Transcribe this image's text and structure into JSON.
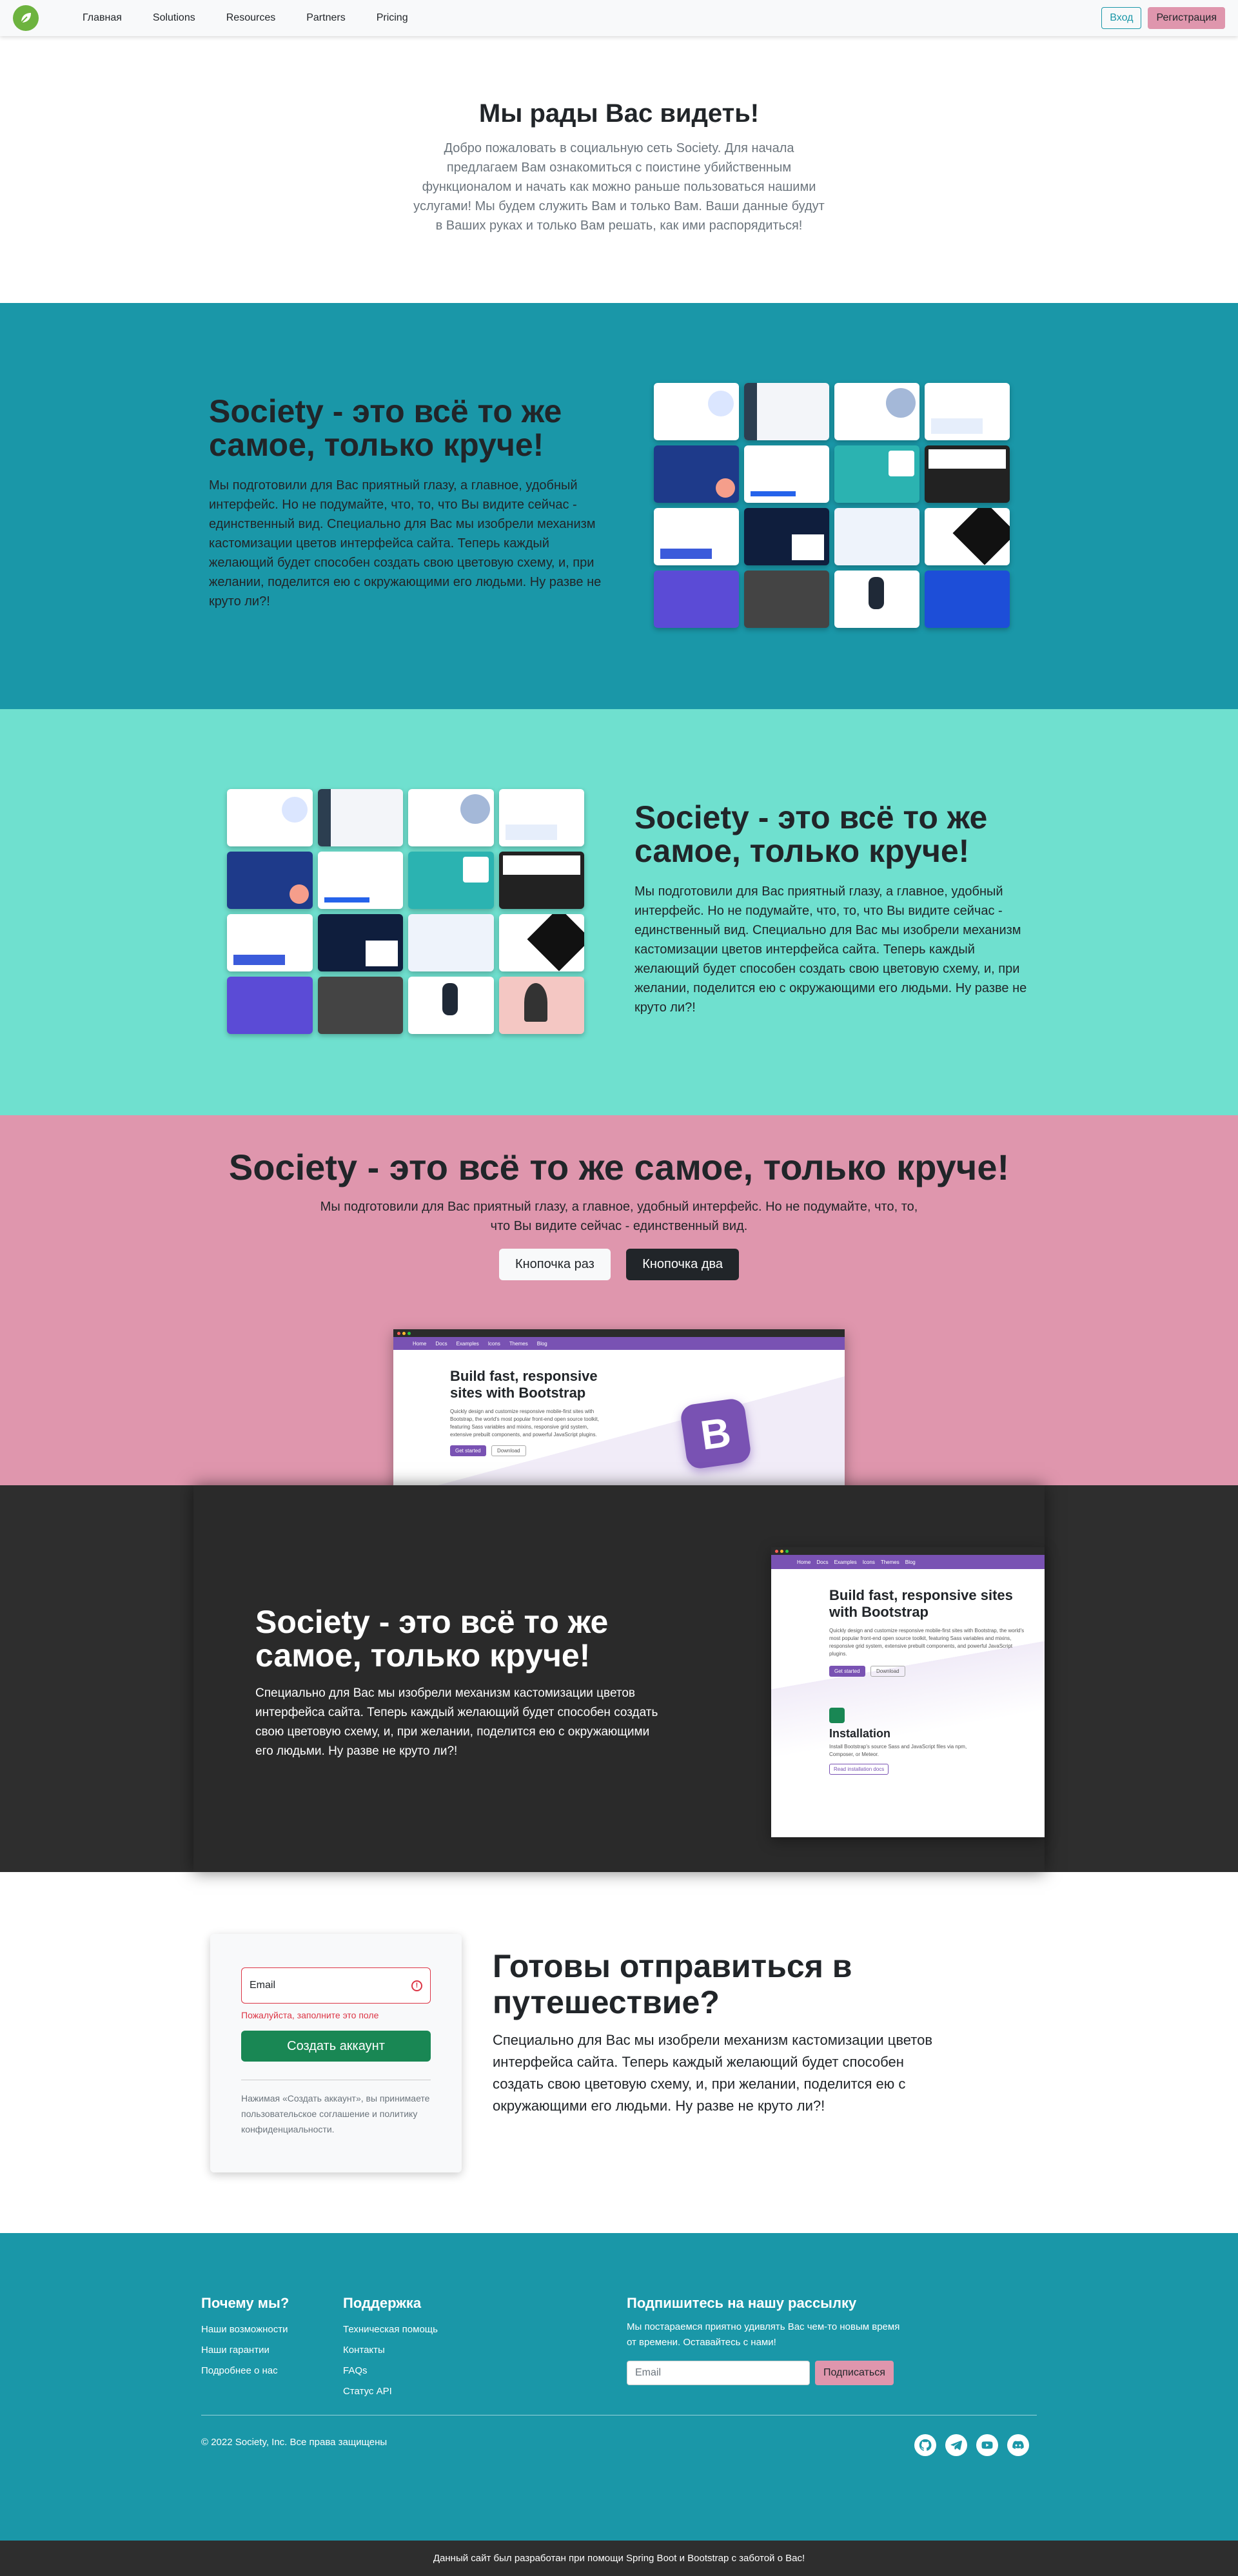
{
  "nav": {
    "links": [
      "Главная",
      "Solutions",
      "Resources",
      "Partners",
      "Pricing"
    ],
    "login": "Вход",
    "register": "Регистрация"
  },
  "hero": {
    "title": "Мы рады Вас видеть!",
    "text": "Добро пожаловать в социальную сеть Society. Для начала предлагаем Вам ознакомиться с поистине убийственным функционалом и начать как можно раньше пользоваться нашими услугами! Мы будем служить Вам и только Вам. Ваши данные будут в Ваших руках и только Вам решать, как ими распорядиться!"
  },
  "feature1": {
    "title": "Society - это всё то же самое, только круче!",
    "text": "Мы подготовили для Вас приятный глазу, а главное, удобный интерфейс. Но не подумайте, что, то, что Вы видите сейчас - единственный вид. Специально для Вас мы изобрели механизм кастомизации цветов интерфейса сайта. Теперь каждый желающий будет способен создать свою цветовую схему, и, при желании, поделится ею с окружающими его людьми. Ну разве не круто ли?!"
  },
  "feature2": {
    "title": "Society - это всё то же самое, только круче!",
    "text": "Мы подготовили для Вас приятный глазу, а главное, удобный интерфейс. Но не подумайте, что, то, что Вы видите сейчас - единственный вид. Специально для Вас мы изобрели механизм кастомизации цветов интерфейса сайта. Теперь каждый желающий будет способен создать свою цветовую схему, и, при желании, поделится ею с окружающими его людьми. Ну разве не круто ли?!"
  },
  "feature3": {
    "title": "Society - это всё то же самое, только круче!",
    "text": "Мы подготовили для Вас приятный глазу, а главное, удобный интерфейс. Но не подумайте, что, то, что Вы видите сейчас - единственный вид.",
    "button1": "Кнопочка раз",
    "button2": "Кнопочка два"
  },
  "feature4": {
    "title": "Society - это всё то же самое, только круче!",
    "text": "Специально для Вас мы изобрели механизм кастомизации цветов интерфейса сайта. Теперь каждый желающий будет способен создать свою цветовую схему, и, при желании, поделится ею с окружающими его людьми. Ну разве не круто ли?!"
  },
  "bootstrap_preview": {
    "nav_items": [
      "Home",
      "Docs",
      "Examples",
      "Icons",
      "Themes",
      "Blog"
    ],
    "title": "Build fast, responsive sites with Bootstrap",
    "text": "Quickly design and customize responsive mobile-first sites with Bootstrap, the world's most popular front-end open source toolkit, featuring Sass variables and mixins, responsive grid system, extensive prebuilt components, and powerful JavaScript plugins.",
    "btn_primary": "Get started",
    "btn_secondary": "Download",
    "logo_letter": "B",
    "install_title": "Installation",
    "install_text": "Install Bootstrap's source Sass and JavaScript files via npm, Composer, or Meteor.",
    "install_link": "Read installation docs"
  },
  "signup": {
    "email_placeholder": "Email",
    "error": "Пожалуйста, заполните это поле",
    "button": "Создать аккаунт",
    "terms": "Нажимая «Создать аккаунт», вы принимаете пользовательское соглашение и политику конфиденциальности.",
    "title": "Готовы отправиться в путешествие?",
    "text": "Специально для Вас мы изобрели механизм кастомизации цветов интерфейса сайта. Теперь каждый желающий будет способен создать свою цветовую схему, и, при желании, поделится ею с окружающими его людьми. Ну разве не круто ли?!"
  },
  "footer": {
    "col1": {
      "title": "Почему мы?",
      "links": [
        "Наши возможности",
        "Наши гарантии",
        "Подробнее о нас"
      ]
    },
    "col2": {
      "title": "Поддержка",
      "links": [
        "Техническая помощь",
        "Контакты",
        "FAQs",
        "Статус API"
      ]
    },
    "newsletter": {
      "title": "Подпишитесь на нашу рассылку",
      "text": "Мы постараемся приятно удивлять Вас чем-то новым время от времени. Оставайтесь с нами!",
      "placeholder": "Email",
      "button": "Подписаться"
    },
    "copyright": "© 2022 Society, Inc. Все права защищены",
    "socials": [
      "github-icon",
      "telegram-icon",
      "youtube-icon",
      "discord-icon"
    ],
    "bottom": "Данный сайт был разработан при помощи Spring Boot и Bootstrap с заботой о Вас!"
  },
  "colors": {
    "teal": "#1a97a8",
    "mint": "#6fe0cf",
    "pink": "#df96ad",
    "dark": "#2e2e2e",
    "bootstrap_purple": "#7952b3"
  }
}
